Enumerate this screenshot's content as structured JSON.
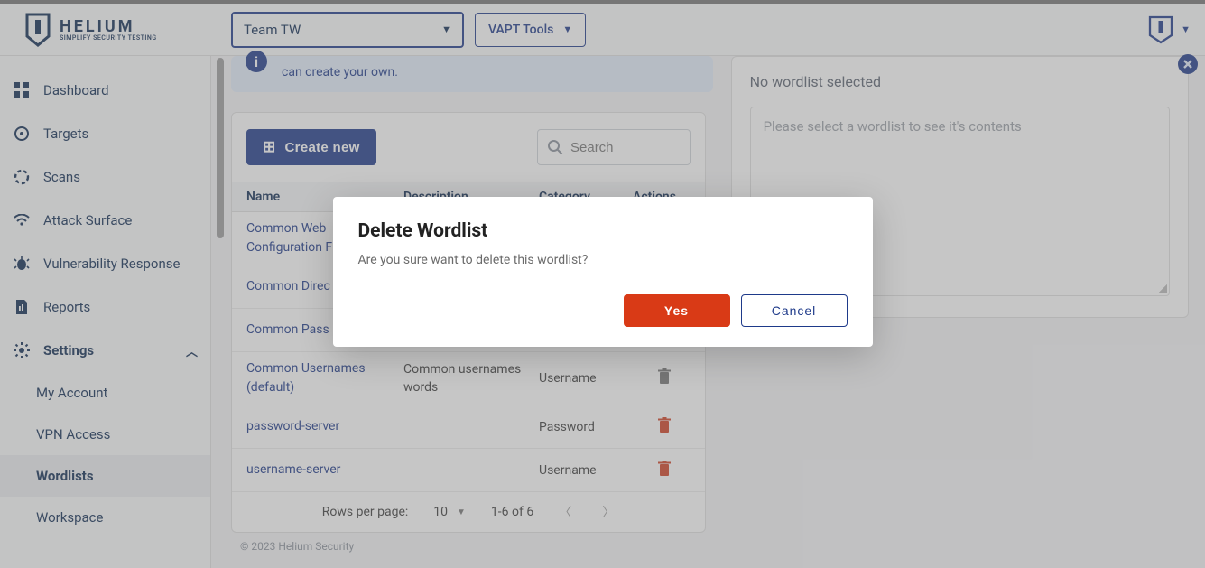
{
  "brand": {
    "name": "HELIUM",
    "tagline": "SIMPLIFY SECURITY TESTING"
  },
  "header": {
    "team_label": "Team TW",
    "tools_label": "VAPT Tools"
  },
  "sidebar": {
    "items": [
      {
        "label": "Dashboard"
      },
      {
        "label": "Targets"
      },
      {
        "label": "Scans"
      },
      {
        "label": "Attack Surface"
      },
      {
        "label": "Vulnerability Response"
      },
      {
        "label": "Reports"
      }
    ],
    "settings_label": "Settings",
    "sub": [
      {
        "label": "My Account"
      },
      {
        "label": "VPN Access"
      },
      {
        "label": "Wordlists"
      },
      {
        "label": "Workspace"
      }
    ]
  },
  "banner": {
    "text": "can create your own."
  },
  "toolbar": {
    "create_label": "Create new",
    "search_placeholder": "Search"
  },
  "table": {
    "headers": {
      "name": "Name",
      "desc": "Description",
      "cat": "Category",
      "act": "Actions"
    },
    "rows": [
      {
        "name": "Common Web Configuration F (default)",
        "desc": "",
        "cat": "",
        "deletable": false
      },
      {
        "name": "Common Direc (default)",
        "desc": "",
        "cat": "",
        "deletable": false
      },
      {
        "name": "Common Pass (default)",
        "desc": "",
        "cat": "",
        "deletable": false
      },
      {
        "name": "Common Usernames (default)",
        "desc": "Common usernames words",
        "cat": "Username",
        "deletable": false
      },
      {
        "name": "password-server",
        "desc": "",
        "cat": "Password",
        "deletable": true
      },
      {
        "name": "username-server",
        "desc": "",
        "cat": "Username",
        "deletable": true
      }
    ]
  },
  "pager": {
    "rows_label": "Rows per page:",
    "rows_value": "10",
    "range": "1-6 of 6"
  },
  "detail": {
    "empty_title": "No wordlist selected",
    "empty_body": "Please select a wordlist to see it's contents"
  },
  "banner_close_info": {
    "visible": true
  },
  "footer": "© 2023 Helium Security",
  "modal": {
    "title": "Delete Wordlist",
    "message": "Are you sure want to delete this wordlist?",
    "yes": "Yes",
    "cancel": "Cancel"
  }
}
